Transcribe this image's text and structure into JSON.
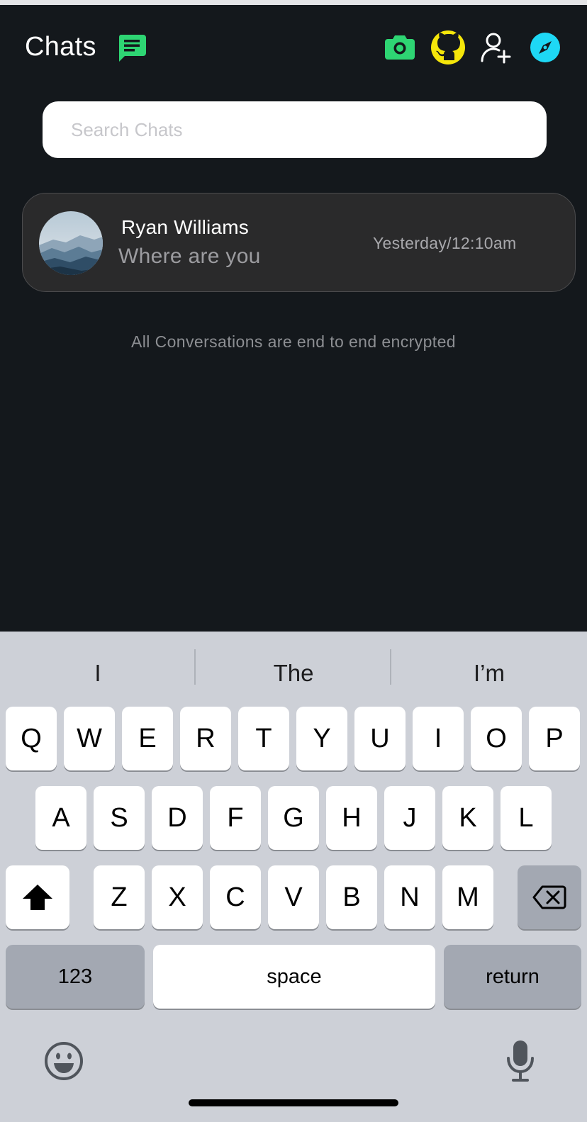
{
  "header": {
    "title": "Chats",
    "icons": [
      "chat-icon",
      "camera-icon",
      "github-icon",
      "add-user-icon",
      "compass-icon"
    ],
    "colors": {
      "chat": "#2ed573",
      "camera": "#2ed573",
      "github": "#f5e60a",
      "compass": "#1ed8f5"
    }
  },
  "search": {
    "placeholder": "Search Chats",
    "value": ""
  },
  "chats": [
    {
      "name": "Ryan Williams",
      "message": "Where are you",
      "time": "Yesterday/12:10am",
      "avatar": "mountain-landscape"
    }
  ],
  "footer_note": "All Conversations are end to end encrypted",
  "keyboard": {
    "suggestions": [
      "I",
      "The",
      "I’m"
    ],
    "rows": [
      [
        "Q",
        "W",
        "E",
        "R",
        "T",
        "Y",
        "U",
        "I",
        "O",
        "P"
      ],
      [
        "A",
        "S",
        "D",
        "F",
        "G",
        "H",
        "J",
        "K",
        "L"
      ],
      [
        "Z",
        "X",
        "C",
        "V",
        "B",
        "N",
        "M"
      ]
    ],
    "numbers_label": "123",
    "space_label": "space",
    "return_label": "return",
    "icons": [
      "shift-icon",
      "backspace-icon",
      "emoji-icon",
      "microphone-icon"
    ]
  }
}
